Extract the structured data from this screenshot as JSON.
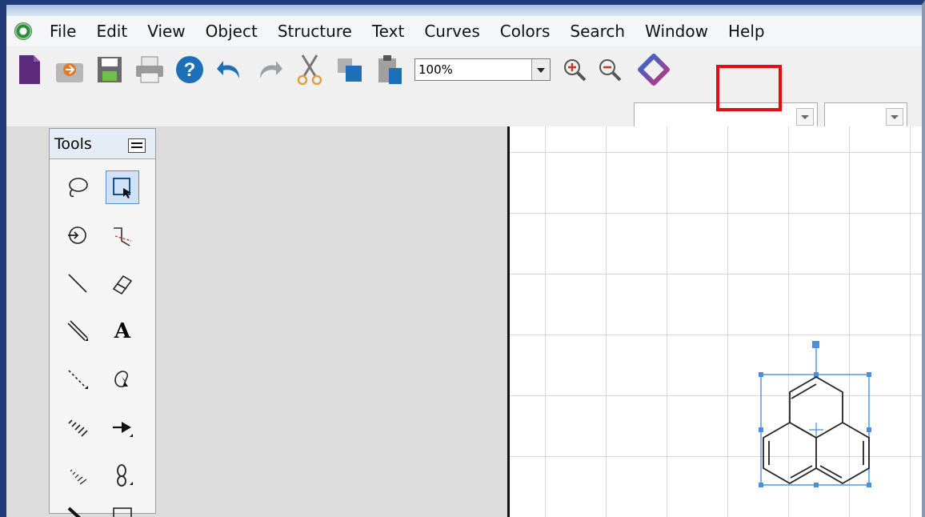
{
  "menu": {
    "items": [
      "File",
      "Edit",
      "View",
      "Object",
      "Structure",
      "Text",
      "Curves",
      "Colors",
      "Search",
      "Window",
      "Help"
    ]
  },
  "toolbar": {
    "zoom_value": "100%",
    "buttons": [
      "new-document-icon",
      "open-icon",
      "save-icon",
      "print-icon",
      "help-icon",
      "undo-icon",
      "redo-icon",
      "cut-icon",
      "copy-icon",
      "paste-icon",
      "zoom-in-icon",
      "zoom-out-icon",
      "clean-structure-icon"
    ],
    "highlight_color": "#e11010"
  },
  "tools_palette": {
    "title": "Tools",
    "text_tool_label": "A"
  },
  "colors": {
    "selection": "#4a90d9",
    "window_border": "#1f3c78"
  }
}
